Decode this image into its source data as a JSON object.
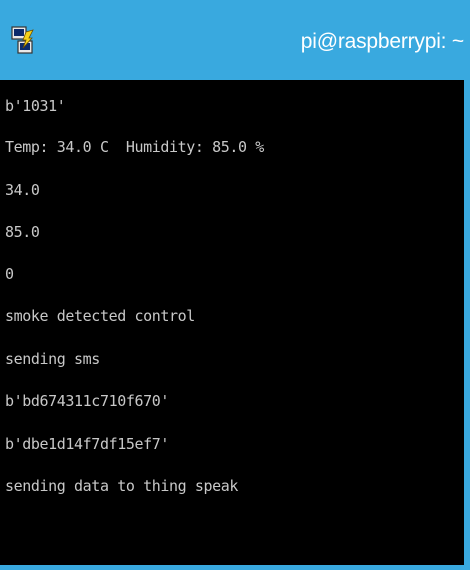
{
  "window": {
    "title": "pi@raspberrypi: ~",
    "icon": "putty-icon",
    "colors": {
      "titlebar": "#39a9df",
      "terminal_bg": "#000000",
      "terminal_fg": "#c8c8c8"
    }
  },
  "terminal": {
    "lines": [
      "b'1031'",
      "Temp: 34.0 C  Humidity: 85.0 %",
      "34.0",
      "85.0",
      "0",
      "smoke detected control",
      "sending sms",
      "b'bd674311c710f670'",
      "b'dbe1d14f7df15ef7'",
      "sending data to thing speak"
    ]
  }
}
